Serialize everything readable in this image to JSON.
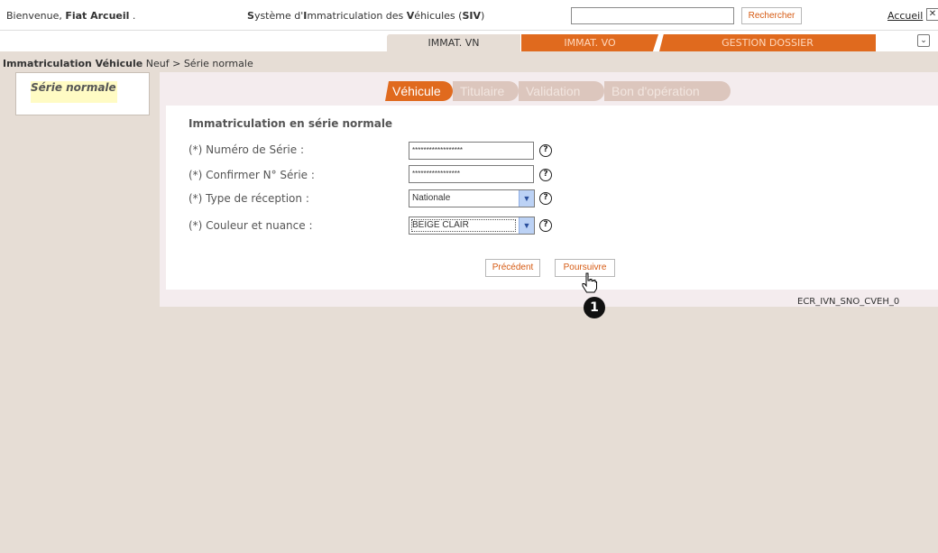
{
  "header": {
    "welcome_prefix": "Bienvenue,",
    "welcome_user": "Fiat Arcueil",
    "welcome_suffix": ".",
    "system_title_start": "S",
    "system_title_rest1": "ystème d'",
    "system_title_i": "I",
    "system_title_rest2": "mmatriculation des ",
    "system_title_v": "V",
    "system_title_rest3": "éhicules (",
    "system_title_abbr": "SIV",
    "system_title_end": ")",
    "search_value": "",
    "search_button": "Rechercher",
    "home_link": "Accueil",
    "close_icon": "close-icon"
  },
  "tabs": [
    {
      "label": "IMMAT. VN",
      "active": true
    },
    {
      "label": "IMMAT. VO",
      "active": false
    },
    {
      "label": "GESTION DOSSIER",
      "active": false
    }
  ],
  "breadcrumb": {
    "section": "Immatriculation Véhicule",
    "section_tail": " Neuf",
    "separator": " > ",
    "page": "Série normale"
  },
  "sidebar": {
    "items": [
      {
        "label": "Série normale",
        "selected": true
      }
    ]
  },
  "steps": [
    {
      "label": "Véhicule",
      "active": true
    },
    {
      "label": "Titulaire",
      "active": false
    },
    {
      "label": "Validation",
      "active": false
    },
    {
      "label": "Bon d'opération",
      "active": false
    }
  ],
  "form": {
    "title": "Immatriculation en série normale",
    "fields": [
      {
        "label": "(*) Numéro de Série :",
        "value": "******************",
        "type": "password"
      },
      {
        "label": "(*) Confirmer N° Série :",
        "value": "*****************",
        "type": "password"
      },
      {
        "label": "(*) Type de réception :",
        "value": "Nationale",
        "type": "select"
      },
      {
        "label": "(*) Couleur et nuance :",
        "value": "BEIGE CLAIR",
        "type": "select"
      }
    ],
    "help_symbol": "?",
    "prev_button": "Précédent",
    "next_button": "Poursuivre"
  },
  "annotation": {
    "step_number": "1"
  },
  "screen_code": "ECR_IVN_SNO_CVEH_0",
  "colors": {
    "accent": "#e06a1e",
    "background": "#e6ddd5",
    "panel": "#f4ecee"
  }
}
